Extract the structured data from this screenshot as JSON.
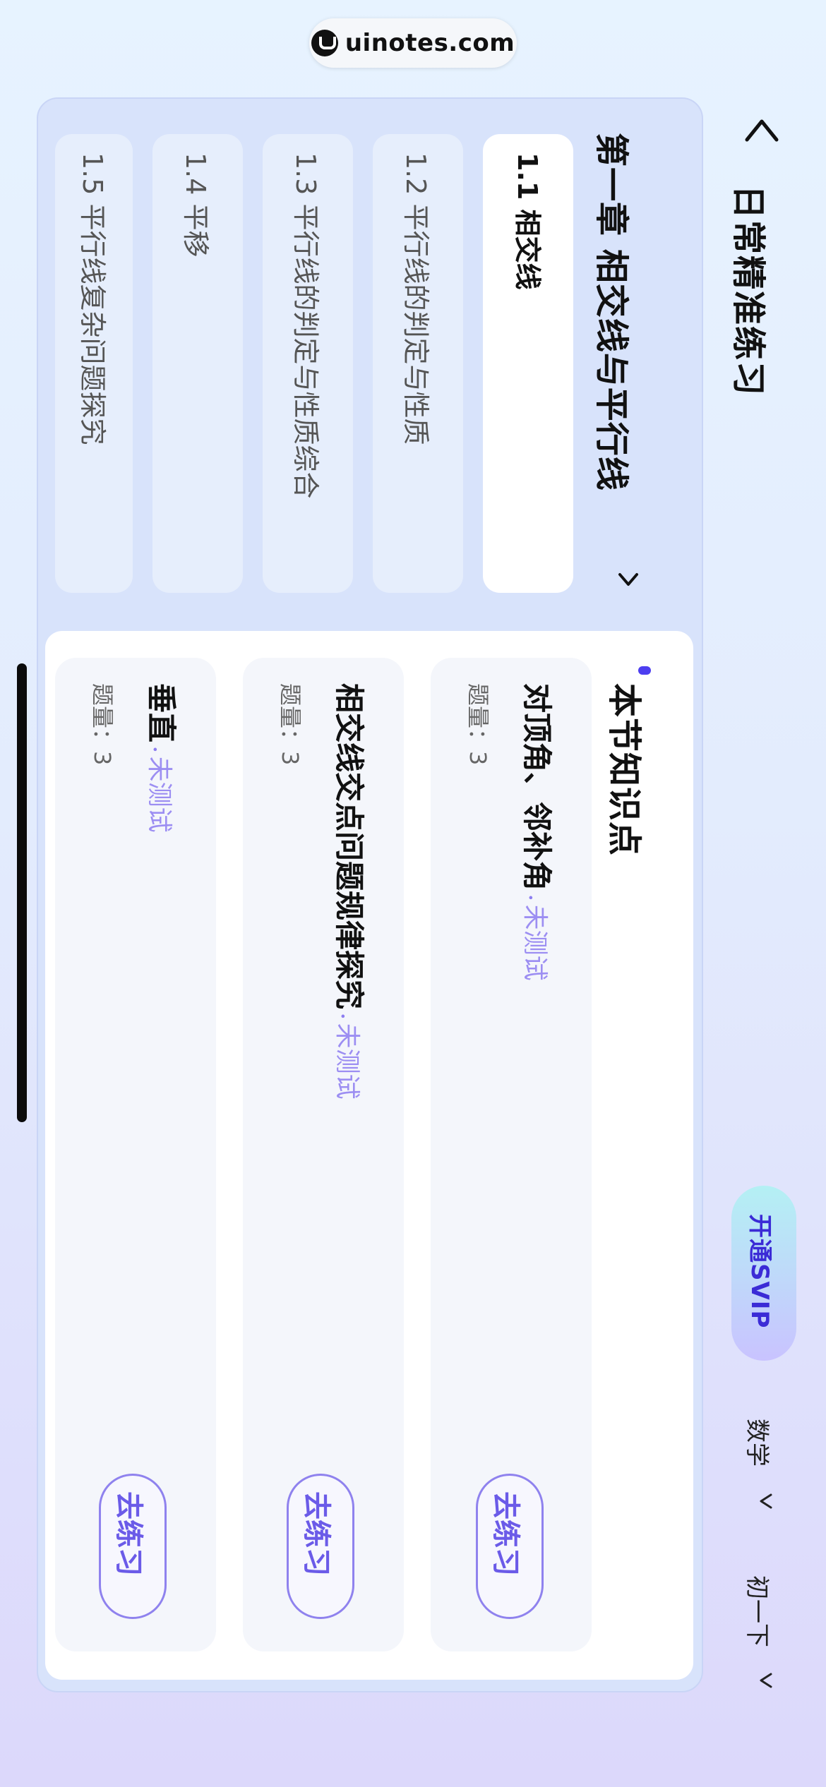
{
  "watermark": {
    "text": "uinotes.com"
  },
  "header": {
    "title": "日常精准练习",
    "svip_label": "开通SVIP",
    "subject": "数学",
    "grade": "初一下"
  },
  "chapter": {
    "title": "第一章 相交线与平行线",
    "sections": [
      {
        "label": "1.1 相交线",
        "active": true
      },
      {
        "label": "1.2 平行线的判定与性质",
        "active": false
      },
      {
        "label": "1.3 平行线的判定与性质综合",
        "active": false
      },
      {
        "label": "1.4 平移",
        "active": false
      },
      {
        "label": "1.5 平行线复杂问题探究",
        "active": false
      }
    ]
  },
  "knowledge": {
    "title": "本节知识点",
    "items": [
      {
        "name": "对顶角、邻补角",
        "status": "未测试",
        "count": "题量：3",
        "button": "去练习"
      },
      {
        "name": "相交线交点问题规律探究",
        "status": "未测试",
        "count": "题量：3",
        "button": "去练习"
      },
      {
        "name": "垂直",
        "status": "未测试",
        "count": "题量：3",
        "button": "去练习"
      }
    ],
    "dot": "•"
  },
  "colors": {
    "accent": "#6b5be8",
    "svip_text": "#3b2bd6",
    "status": "#9c8ef2"
  }
}
